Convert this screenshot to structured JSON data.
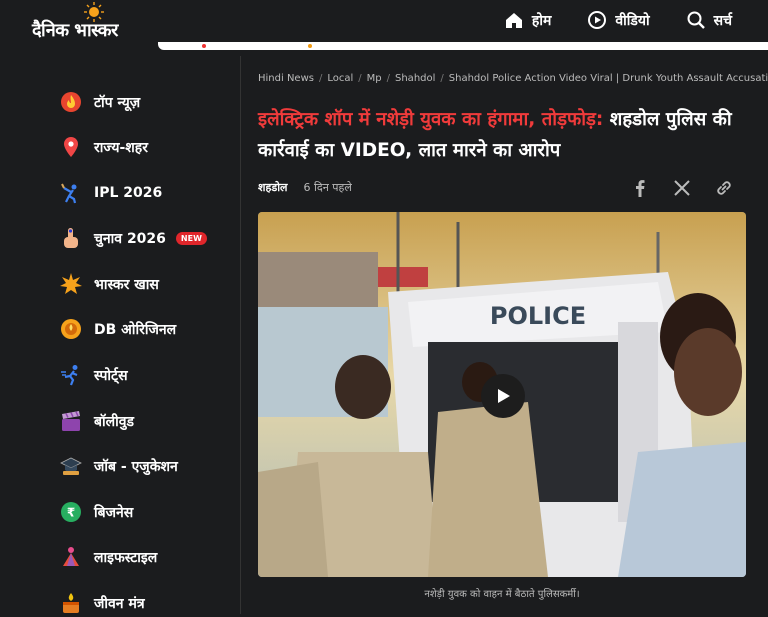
{
  "header": {
    "logo_text": "दैनिक भास्कर",
    "nav": [
      {
        "label": "होम",
        "icon": "home-icon"
      },
      {
        "label": "वीडियो",
        "icon": "play-circle-icon"
      },
      {
        "label": "सर्च",
        "icon": "search-icon"
      }
    ]
  },
  "sidebar": {
    "items": [
      {
        "label": "टॉप न्यूज़",
        "icon": "fire-icon"
      },
      {
        "label": "राज्य-शहर",
        "icon": "location-pin-icon"
      },
      {
        "label": "IPL 2026",
        "icon": "cricket-icon"
      },
      {
        "label": "चुनाव 2026",
        "icon": "voting-finger-icon",
        "badge": "NEW"
      },
      {
        "label": "भास्कर खास",
        "icon": "star-burst-icon"
      },
      {
        "label": "DB ओरिजिनल",
        "icon": "db-original-icon"
      },
      {
        "label": "स्पोर्ट्स",
        "icon": "runner-icon"
      },
      {
        "label": "बॉलीवुड",
        "icon": "clapperboard-icon"
      },
      {
        "label": "जॉब - एजुकेशन",
        "icon": "graduation-cap-icon"
      },
      {
        "label": "बिजनेस",
        "icon": "rupee-icon"
      },
      {
        "label": "लाइफस्टाइल",
        "icon": "lifestyle-icon"
      },
      {
        "label": "जीवन मंत्र",
        "icon": "diya-icon"
      }
    ]
  },
  "article": {
    "breadcrumb": [
      "Hindi News",
      "Local",
      "Mp",
      "Shahdol",
      "Shahdol Police Action Video Viral | Drunk Youth Assault Accusation"
    ],
    "headline_red": "इलेक्ट्रिक शॉप में नशेड़ी युवक का हंगामा, तोड़फोड़:",
    "headline_rest": " शहडोल पुलिस की कार्रवाई का VIDEO, लात मारने का आरोप",
    "city": "शहडोल",
    "time": "6 दिन पहले",
    "video_caption": "नशेड़ी युवक को वाहन में बैठाते पुलिसकर्मी।",
    "video_text": "POLICE"
  },
  "colors": {
    "accent_red": "#f03b3b",
    "badge_red": "#e0262b",
    "background": "#1b1c1e"
  }
}
